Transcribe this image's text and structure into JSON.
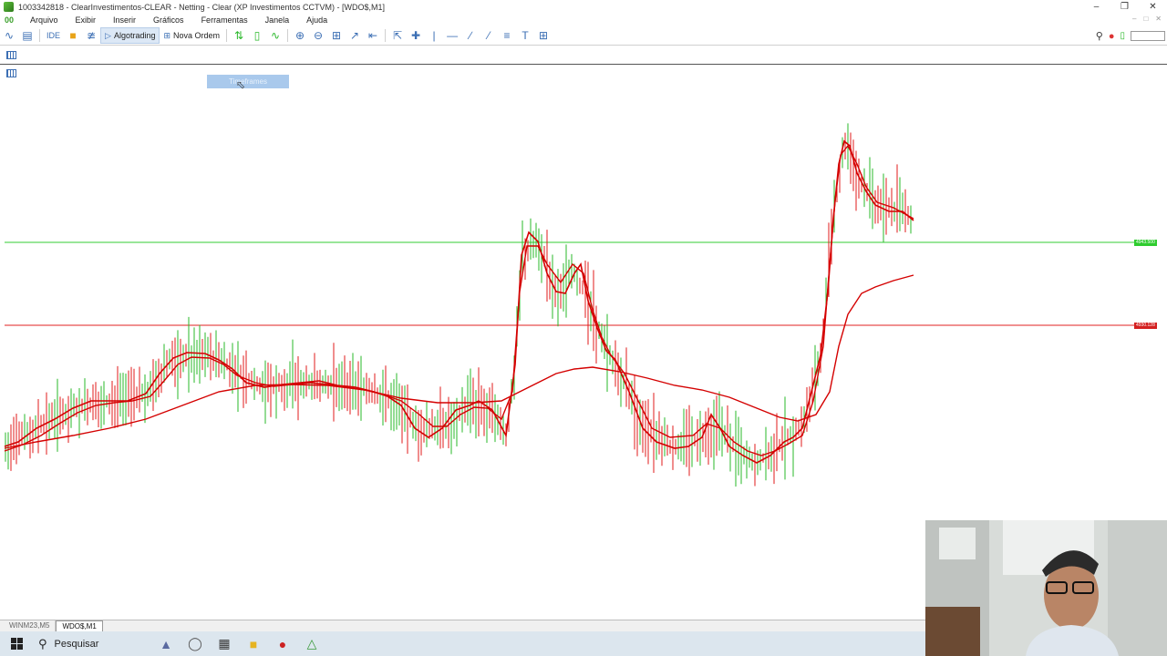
{
  "window": {
    "title": "1003342818 - ClearInvestimentos-CLEAR - Netting - Clear (XP Investimentos CCTVM) - [WDO$,M1]",
    "minimize": "–",
    "restore": "❐",
    "close": "✕"
  },
  "menu": {
    "items": [
      "Arquivo",
      "Exibir",
      "Inserir",
      "Gráficos",
      "Ferramentas",
      "Janela",
      "Ajuda"
    ]
  },
  "toolbar": {
    "ide_label": "IDE",
    "algotrading_label": "Algotrading",
    "nova_ordem_label": "Nova Ordem"
  },
  "chart": {
    "timeframes_label": "Timeframes",
    "price_green": "4943.500",
    "price_red": "4930.128",
    "colors": {
      "bull": "#2ab82a",
      "bear": "#e01b1b",
      "ma": "#d40000",
      "green_line": "#33cc33",
      "red_line": "#e02020"
    }
  },
  "tabs": [
    "WINM23,M5",
    "WDO$,M1"
  ],
  "taskbar": {
    "search_label": "Pesquisar"
  }
}
